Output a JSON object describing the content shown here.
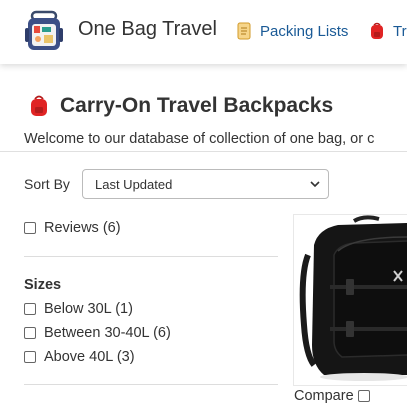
{
  "header": {
    "brand": "One Bag Travel",
    "nav": [
      {
        "label": "Packing Lists",
        "icon": "scroll-icon"
      },
      {
        "label": "Tra",
        "icon": "backpack-icon"
      }
    ]
  },
  "page": {
    "title": "Carry-On Travel Backpacks",
    "intro": "Welcome to our database of collection of one bag, or c"
  },
  "sort": {
    "label": "Sort By",
    "selected": "Last Updated"
  },
  "filters": {
    "reviews": {
      "label": "Reviews (6)",
      "checked": false
    },
    "sizes": {
      "heading": "Sizes",
      "options": [
        {
          "label": "Below 30L (1)",
          "checked": false
        },
        {
          "label": "Between 30-40L (6)",
          "checked": false
        },
        {
          "label": "Above 40L (3)",
          "checked": false
        }
      ]
    }
  },
  "product": {
    "compare_label": "Compare",
    "compare_checked": false
  },
  "colors": {
    "accent_red": "#e02424",
    "nav_link": "#1a5a96"
  }
}
